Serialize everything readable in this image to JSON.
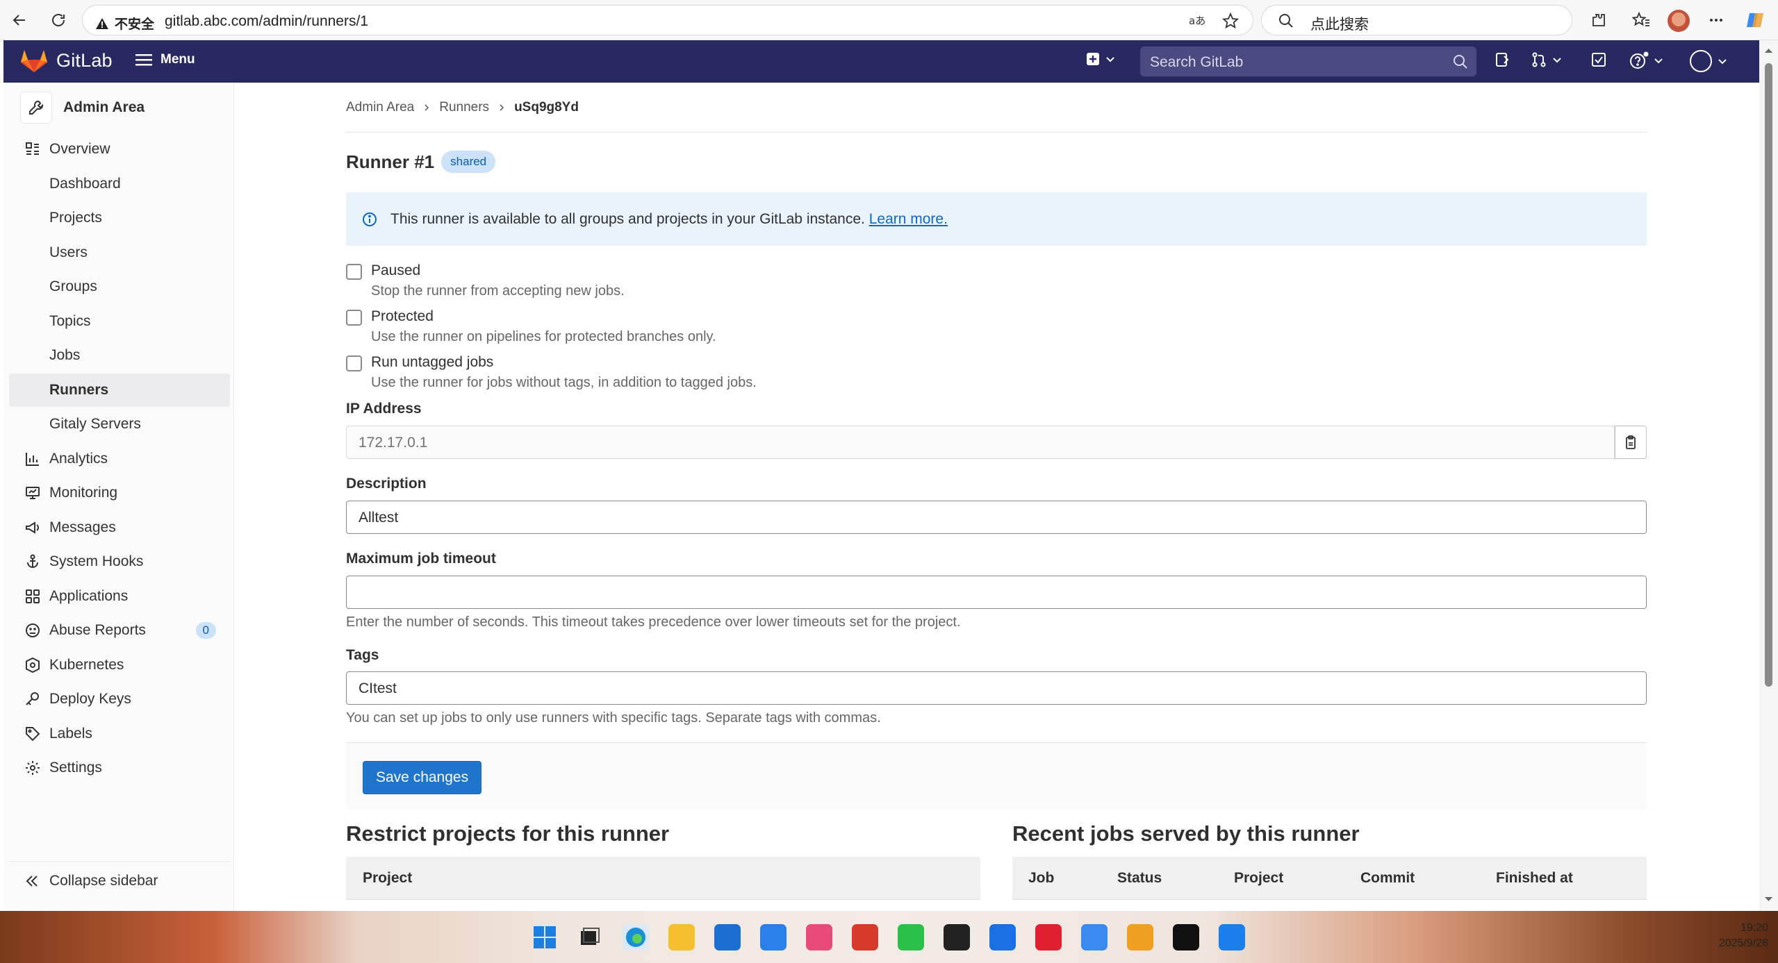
{
  "browser": {
    "security_label": "不安全",
    "url": "gitlab.abc.com/admin/runners/1",
    "search_placeholder": "点此搜索"
  },
  "topbar": {
    "brand": "GitLab",
    "menu_label": "Menu",
    "search_placeholder": "Search GitLab"
  },
  "sidebar": {
    "header": "Admin Area",
    "overview": "Overview",
    "overview_items": [
      "Dashboard",
      "Projects",
      "Users",
      "Groups",
      "Topics",
      "Jobs",
      "Runners",
      "Gitaly Servers"
    ],
    "sections": [
      "Analytics",
      "Monitoring",
      "Messages",
      "System Hooks",
      "Applications",
      "Abuse Reports",
      "Kubernetes",
      "Deploy Keys",
      "Labels",
      "Settings"
    ],
    "abuse_count": "0",
    "collapse": "Collapse sidebar"
  },
  "breadcrumb": [
    "Admin Area",
    "Runners",
    "uSq9g8Yd"
  ],
  "runner": {
    "title": "Runner #1",
    "badge": "shared",
    "alert_text": "This runner is available to all groups and projects in your GitLab instance.",
    "alert_link": "Learn more."
  },
  "form": {
    "paused_label": "Paused",
    "paused_help": "Stop the runner from accepting new jobs.",
    "protected_label": "Protected",
    "protected_help": "Use the runner on pipelines for protected branches only.",
    "untagged_label": "Run untagged jobs",
    "untagged_help": "Use the runner for jobs without tags, in addition to tagged jobs.",
    "ip_label": "IP Address",
    "ip_value": "172.17.0.1",
    "desc_label": "Description",
    "desc_value": "Alltest",
    "timeout_label": "Maximum job timeout",
    "timeout_value": "",
    "timeout_help": "Enter the number of seconds. This timeout takes precedence over lower timeouts set for the project.",
    "tags_label": "Tags",
    "tags_value": "CItest",
    "tags_help": "You can set up jobs to only use runners with specific tags. Separate tags with commas.",
    "save_label": "Save changes"
  },
  "restrict": {
    "title": "Restrict projects for this runner",
    "column": "Project"
  },
  "recent": {
    "title": "Recent jobs served by this runner",
    "columns": [
      "Job",
      "Status",
      "Project",
      "Commit",
      "Finished at"
    ]
  },
  "taskbar": {
    "time": "19:20",
    "date": "2025/9/26"
  },
  "colors": {
    "topbar": "#292961",
    "primary_button": "#1f75cb",
    "alert_bg": "#e9f3fc",
    "badge_bg": "#cbe2f9"
  }
}
